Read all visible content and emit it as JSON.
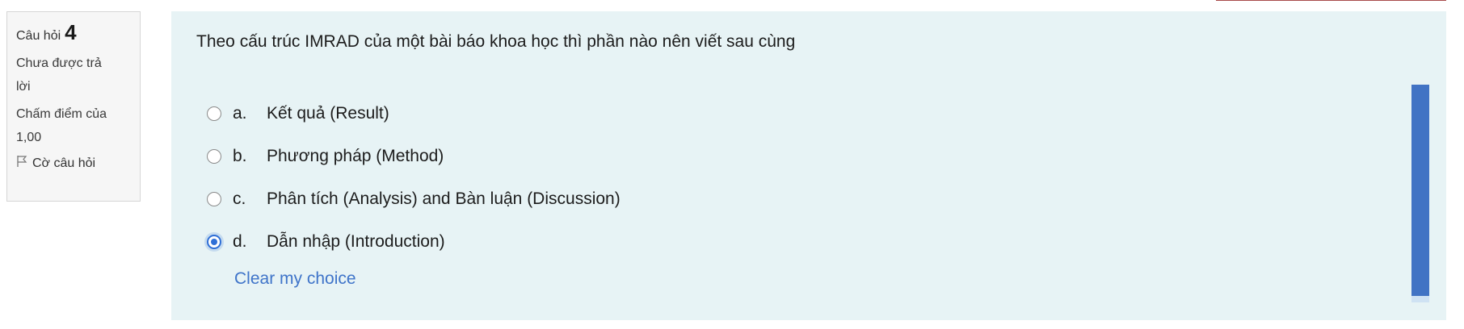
{
  "question_info": {
    "label": "Câu hỏi",
    "number": "4",
    "status_line1": "Chưa được trả",
    "status_line2": "lời",
    "grade_line1": "Chấm điểm của",
    "grade_line2": "1,00",
    "flag_label": "Cờ câu hỏi",
    "flag_icon": "flag-outline-icon"
  },
  "question": {
    "text": "Theo cấu trúc IMRAD của một bài báo khoa học thì phần nào nên viết sau cùng",
    "options": [
      {
        "letter": "a.",
        "text": "Kết quả (Result)",
        "selected": false
      },
      {
        "letter": "b.",
        "text": "Phương pháp (Method)",
        "selected": false
      },
      {
        "letter": "c.",
        "text": "Phân tích (Analysis) and Bàn luận (Discussion)",
        "selected": false
      },
      {
        "letter": "d.",
        "text": "Dẫn nhập (Introduction)",
        "selected": true
      }
    ],
    "clear_label": "Clear my choice"
  },
  "colors": {
    "accent": "#2f6fd6",
    "link": "#3f74c9",
    "content_bg": "#e7f3f5",
    "scrollbar": "#4173c4"
  }
}
